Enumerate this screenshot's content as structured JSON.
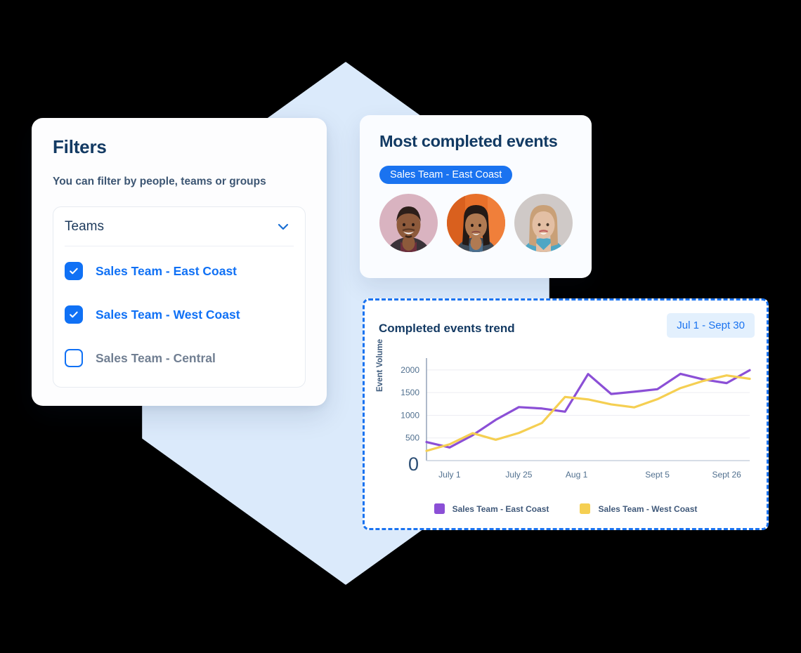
{
  "filters": {
    "title": "Filters",
    "subtitle": "You can filter by people, teams or groups",
    "dropdown": {
      "label": "Teams",
      "chevron_icon": "chevron-down-icon"
    },
    "options": [
      {
        "label": "Sales Team - East Coast",
        "checked": true
      },
      {
        "label": "Sales Team - West Coast",
        "checked": true
      },
      {
        "label": "Sales Team - Central",
        "checked": false
      }
    ]
  },
  "events": {
    "title": "Most completed events",
    "pill_label": "Sales Team - East Coast",
    "avatars": [
      {
        "name": "avatar-person-1",
        "bg": "#d9b3c0",
        "skin": "#8d5a3b",
        "hair": "#2c1f1a",
        "shirt": "#6d2f3d",
        "jacket": "#3a3238"
      },
      {
        "name": "avatar-person-2",
        "bg": "#e8702a",
        "skin": "#b07a52",
        "hair": "#241a16",
        "shirt": "#4a6f8f",
        "jacket": "#3d4a57"
      },
      {
        "name": "avatar-person-3",
        "bg": "#cfc9c7",
        "skin": "#e3bfa4",
        "hair": "#c9a077",
        "shirt": "#4fa6c4",
        "jacket": "#6fbdd6"
      }
    ]
  },
  "chart_card": {
    "title": "Completed events trend",
    "date_badge": "Jul 1 - Sept 30",
    "zero_label": "0"
  },
  "colors": {
    "accent_blue": "#1a73f0",
    "badge_bg": "#e3f0fd",
    "east_coast": "#8b4fd6",
    "west_coast": "#f5cf52",
    "blob": "#dbeafb",
    "heading": "#133a63"
  },
  "chart_data": {
    "type": "line",
    "title": "Completed events trend",
    "xlabel": "",
    "ylabel": "Event Volume",
    "ylim": [
      0,
      2200
    ],
    "yticks": [
      500,
      1000,
      1500,
      2000
    ],
    "ytick_labels": [
      "500",
      "1000",
      "1500",
      "2000"
    ],
    "x_tick_labels": [
      "July 1",
      "July 25",
      "Aug 1",
      "Sept 5",
      "Sept 26"
    ],
    "x_tick_positions": [
      1,
      4,
      6.5,
      10,
      13
    ],
    "x_index": [
      0,
      1,
      2,
      3,
      4,
      5,
      6,
      7,
      8,
      9,
      10,
      11,
      12,
      13,
      14
    ],
    "grid": true,
    "legend_position": "bottom",
    "series": [
      {
        "name": "Sales Team - East Coast",
        "color": "#8b4fd6",
        "values": [
          410,
          290,
          560,
          900,
          1180,
          1150,
          1080,
          1910,
          1470,
          1520,
          1575,
          1915,
          1790,
          1710,
          1995
        ]
      },
      {
        "name": "Sales Team - West Coast",
        "color": "#f5cf52",
        "values": [
          215,
          360,
          605,
          460,
          610,
          830,
          1405,
          1350,
          1240,
          1175,
          1355,
          1600,
          1760,
          1880,
          1805
        ]
      }
    ]
  }
}
